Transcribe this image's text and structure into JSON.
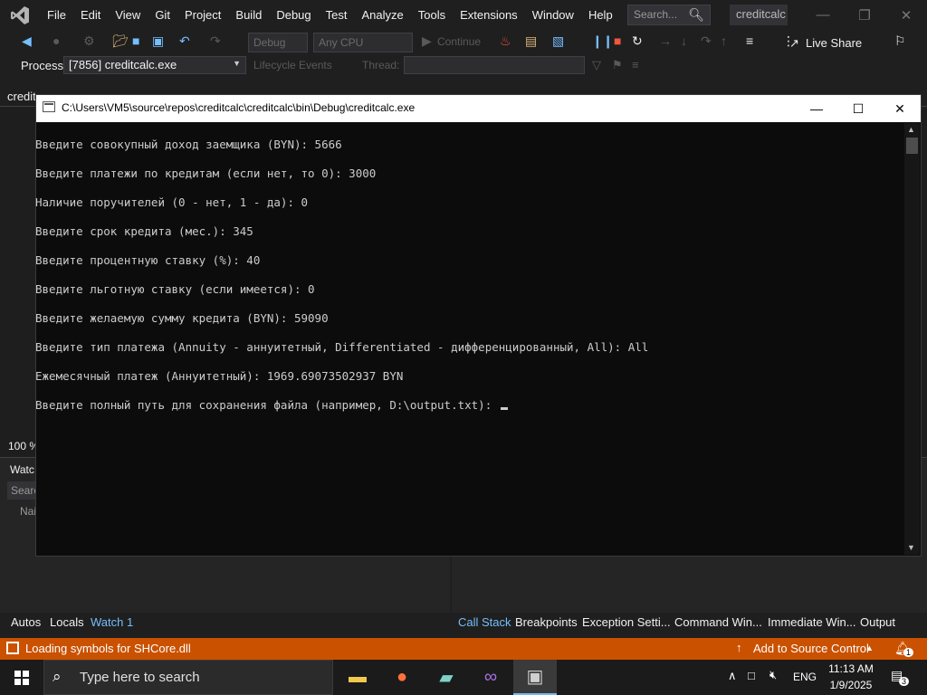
{
  "vs": {
    "menu": [
      "File",
      "Edit",
      "View",
      "Git",
      "Project",
      "Build",
      "Debug",
      "Test",
      "Analyze",
      "Tools",
      "Extensions",
      "Window",
      "Help"
    ],
    "search_placeholder": "Search...",
    "solution_name": "creditcalc",
    "toolbar": {
      "config": "Debug",
      "platform": "Any CPU",
      "continue_label": "Continue",
      "live_share": "Live Share"
    },
    "process": {
      "label": "Process:",
      "value": "[7856] creditcalc.exe",
      "lifecycle": "Lifecycle Events",
      "thread": "Thread:"
    },
    "doc_tab": "creditc",
    "zoom": "100 %",
    "watch": {
      "title": "Watc",
      "search": "Searc",
      "name_header": "Nai"
    },
    "bottom_tabs_left": [
      "Autos",
      "Locals",
      "Watch 1"
    ],
    "bottom_tabs_right": [
      "Call Stack",
      "Breakpoints",
      "Exception Setti...",
      "Command Win...",
      "Immediate Win...",
      "Output"
    ],
    "status": {
      "text": "Loading symbols for SHCore.dll",
      "source_control": "Add to Source Control",
      "notifications": "1"
    }
  },
  "console": {
    "title": "C:\\Users\\VM5\\source\\repos\\creditcalc\\creditcalc\\bin\\Debug\\creditcalc.exe",
    "lines": [
      "Введите совокупный доход заемщика (BYN): 5666",
      "Введите платежи по кредитам (если нет, то 0): 3000",
      "Наличие поручителей (0 - нет, 1 - да): 0",
      "Введите срок кредита (мес.): 345",
      "Введите процентную ставку (%): 40",
      "Введите льготную ставку (если имеется): 0",
      "Введите желаемую сумму кредита (BYN): 59090",
      "Введите тип платежа (Annuity - аннуитетный, Differentiated - дифференцированный, All): All",
      "Ежемесячный платеж (Аннуитетный): 1969.69073502937 BYN",
      "Введите полный путь для сохранения файла (например, D:\\output.txt): "
    ]
  },
  "taskbar": {
    "search_placeholder": "Type here to search",
    "language": "ENG",
    "time": "11:13 AM",
    "date": "1/9/2025",
    "notification_count": "3"
  },
  "colors": {
    "status_bar": "#ca5100",
    "accent": "#75beff",
    "console_bg": "#0c0c0c",
    "console_text": "#cccccc"
  }
}
